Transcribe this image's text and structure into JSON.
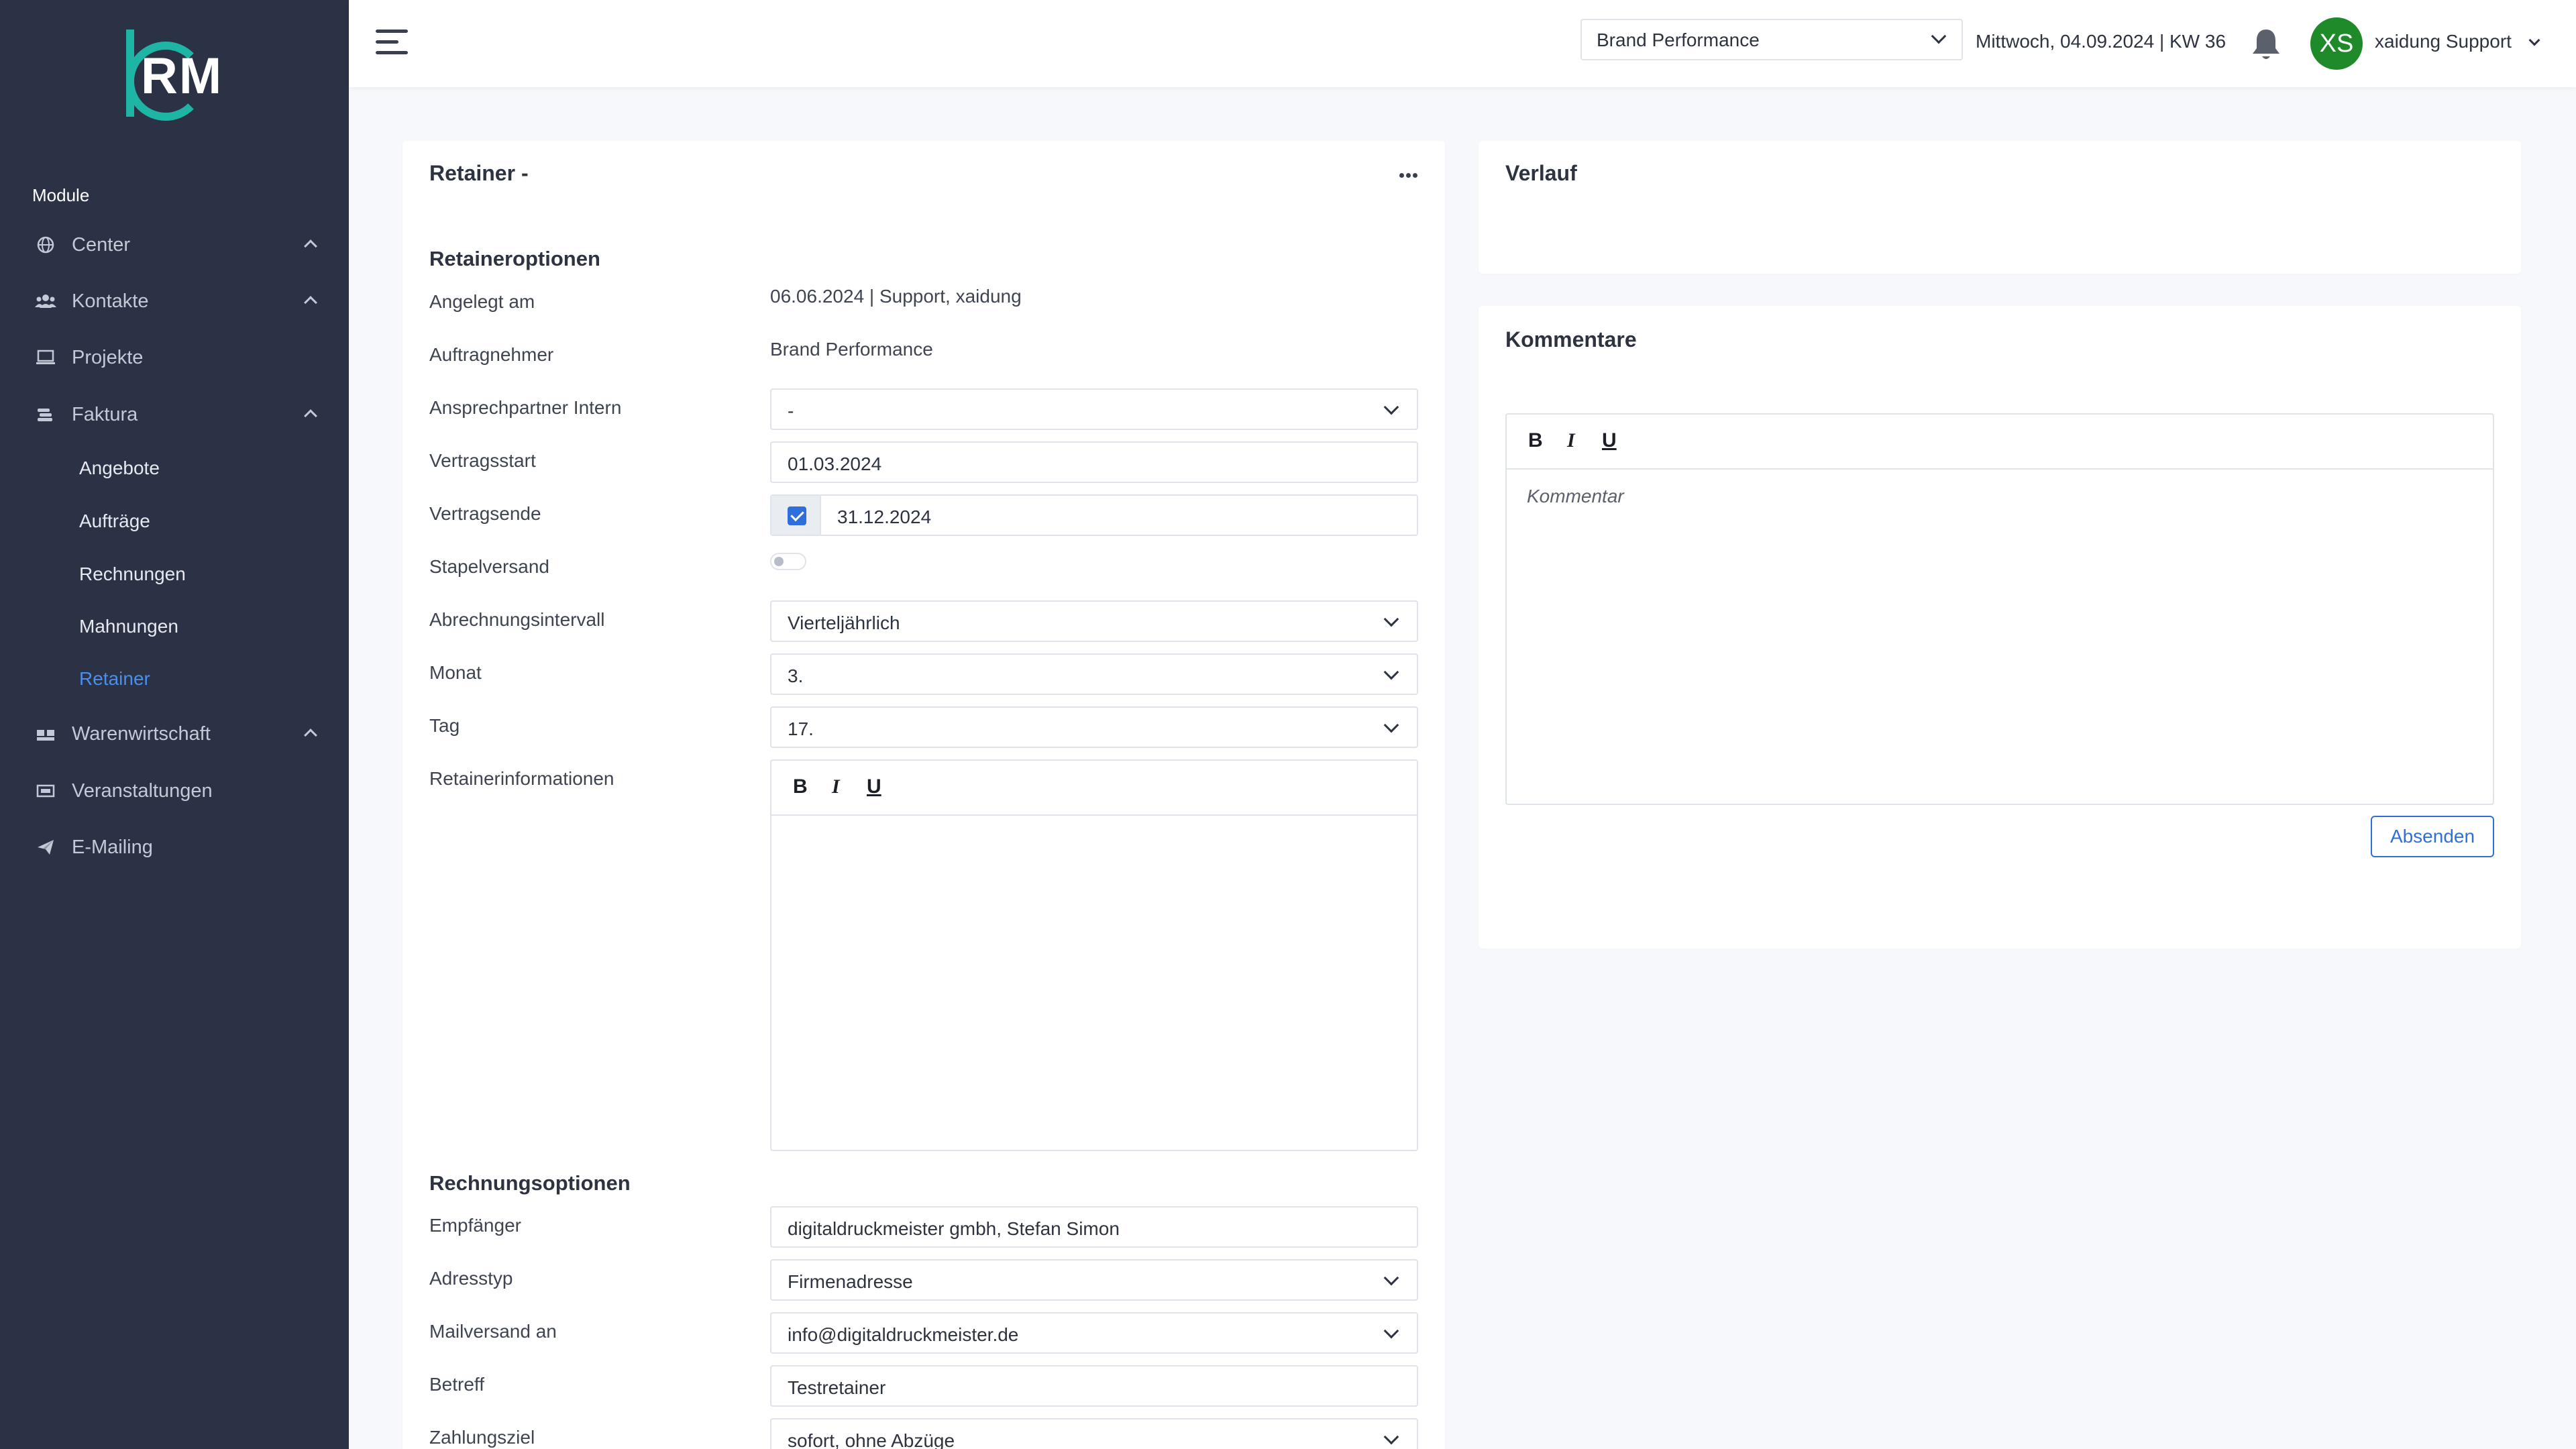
{
  "app": {
    "logo_text": "RM"
  },
  "sidebar": {
    "module_label": "Module",
    "items": [
      {
        "label": "Center",
        "icon": "globe-icon",
        "expandable": true
      },
      {
        "label": "Kontakte",
        "icon": "users-icon",
        "expandable": true
      },
      {
        "label": "Projekte",
        "icon": "laptop-icon",
        "expandable": false
      },
      {
        "label": "Faktura",
        "icon": "coins-icon",
        "expandable": true
      },
      {
        "label": "Warenwirtschaft",
        "icon": "boxes-icon",
        "expandable": true
      },
      {
        "label": "Veranstaltungen",
        "icon": "ticket-icon",
        "expandable": false
      },
      {
        "label": "E-Mailing",
        "icon": "paper-plane-icon",
        "expandable": false
      }
    ],
    "faktura_sub": [
      "Angebote",
      "Aufträge",
      "Rechnungen",
      "Mahnungen",
      "Retainer"
    ],
    "active_sub": "Retainer"
  },
  "topbar": {
    "company": "Brand Performance",
    "date_text": "Mittwoch, 04.09.2024 | KW 36",
    "avatar_initials": "XS",
    "user_name": "xaidung Support"
  },
  "retainer": {
    "title": "Retainer -",
    "options_title": "Retaineroptionen",
    "fields": {
      "angelegt_label": "Angelegt am",
      "angelegt_value": "06.06.2024 | Support, xaidung",
      "auftragnehmer_label": "Auftragnehmer",
      "auftragnehmer_value": "Brand Performance",
      "ansprechpartner_label": "Ansprechpartner Intern",
      "ansprechpartner_value": "-",
      "vertragsstart_label": "Vertragsstart",
      "vertragsstart_value": "01.03.2024",
      "vertragsende_label": "Vertragsende",
      "vertragsende_value": "31.12.2024",
      "stapelversand_label": "Stapelversand",
      "abrechnung_label": "Abrechnungsintervall",
      "abrechnung_value": "Vierteljährlich",
      "monat_label": "Monat",
      "monat_value": "3.",
      "tag_label": "Tag",
      "tag_value": "17.",
      "info_label": "Retainerinformationen"
    },
    "invoice_title": "Rechnungsoptionen",
    "invoice": {
      "empfaenger_label": "Empfänger",
      "empfaenger_value": "digitaldruckmeister gmbh, Stefan Simon",
      "adresstyp_label": "Adresstyp",
      "adresstyp_value": "Firmenadresse",
      "mail_label": "Mailversand an",
      "mail_value": "info@digitaldruckmeister.de",
      "betreff_label": "Betreff",
      "betreff_value": "Testretainer",
      "zahlungsziel_label": "Zahlungsziel",
      "zahlungsziel_value": "sofort, ohne Abzüge"
    }
  },
  "verlauf": {
    "title": "Verlauf"
  },
  "kommentare": {
    "title": "Kommentare",
    "placeholder": "Kommentar",
    "send_label": "Absenden"
  },
  "editor": {
    "bold": "B",
    "italic": "I",
    "underline": "U"
  },
  "colors": {
    "sidebar_bg": "#2b3245",
    "accent": "#2f6fdc",
    "active_nav": "#4a8fe8",
    "avatar": "#1f8a2a",
    "logo": "#1fb5a5"
  }
}
